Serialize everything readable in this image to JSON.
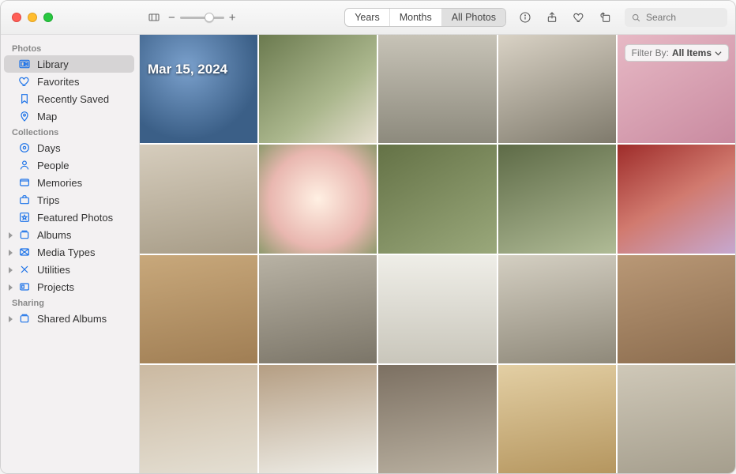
{
  "toolbar": {
    "view_tabs": [
      "Years",
      "Months",
      "All Photos"
    ],
    "active_tab_index": 2,
    "search_placeholder": "Search"
  },
  "sidebar": {
    "sections": [
      {
        "title": "Photos",
        "items": [
          {
            "icon": "photo-library-icon",
            "label": "Library",
            "selected": true,
            "expandable": false
          },
          {
            "icon": "heart-icon",
            "label": "Favorites",
            "selected": false,
            "expandable": false
          },
          {
            "icon": "bookmark-icon",
            "label": "Recently Saved",
            "selected": false,
            "expandable": false
          },
          {
            "icon": "map-pin-icon",
            "label": "Map",
            "selected": false,
            "expandable": false
          }
        ]
      },
      {
        "title": "Collections",
        "items": [
          {
            "icon": "calendar-icon",
            "label": "Days",
            "selected": false,
            "expandable": false
          },
          {
            "icon": "person-icon",
            "label": "People",
            "selected": false,
            "expandable": false
          },
          {
            "icon": "sparkles-icon",
            "label": "Memories",
            "selected": false,
            "expandable": false
          },
          {
            "icon": "suitcase-icon",
            "label": "Trips",
            "selected": false,
            "expandable": false
          },
          {
            "icon": "star-frame-icon",
            "label": "Featured Photos",
            "selected": false,
            "expandable": false
          },
          {
            "icon": "albums-icon",
            "label": "Albums",
            "selected": false,
            "expandable": true
          },
          {
            "icon": "media-types-icon",
            "label": "Media Types",
            "selected": false,
            "expandable": true
          },
          {
            "icon": "utilities-icon",
            "label": "Utilities",
            "selected": false,
            "expandable": true
          },
          {
            "icon": "projects-icon",
            "label": "Projects",
            "selected": false,
            "expandable": true
          }
        ]
      },
      {
        "title": "Sharing",
        "items": [
          {
            "icon": "shared-albums-icon",
            "label": "Shared Albums",
            "selected": false,
            "expandable": true
          }
        ]
      }
    ]
  },
  "content": {
    "date_label": "Mar 15, 2024",
    "filter": {
      "label": "Filter By:",
      "value": "All Items"
    }
  }
}
